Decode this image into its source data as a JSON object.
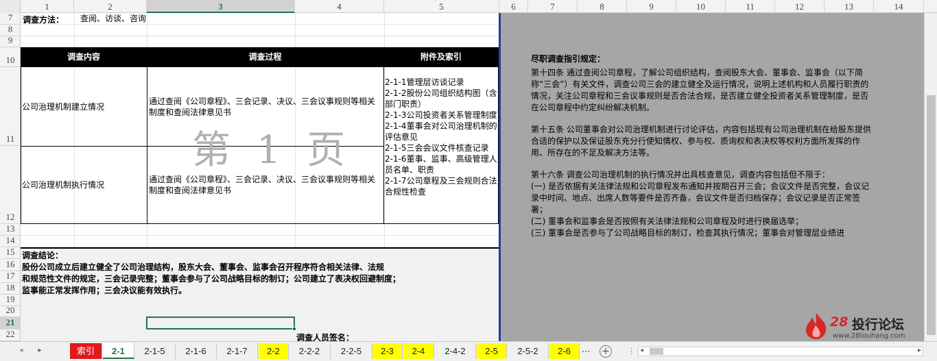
{
  "columns": [
    "1",
    "2",
    "3",
    "4",
    "5",
    "6",
    "7",
    "8",
    "9",
    "10",
    "11",
    "12",
    "13",
    "14"
  ],
  "rows": [
    "7",
    "8",
    "9",
    "10",
    "11",
    "12",
    "13",
    "14",
    "15",
    "16",
    "17",
    "18",
    "19",
    "20",
    "21",
    "22"
  ],
  "sheet": {
    "method_label": "调查方法：",
    "method_value": "查阅、访谈、咨询",
    "table_headers": [
      "调查内容",
      "调查过程",
      "附件及索引"
    ],
    "table_rows": [
      {
        "content": "公司治理机制建立情况",
        "process": "通过查阅《公司章程》、三会记录、决议、三会议事规则等相关制度和查阅法律意见书"
      },
      {
        "content": "公司治理机制执行情况",
        "process": "通过查阅《公司章程》、三会记录、决议、三会议事规则等相关制度和查阅法律意见书"
      }
    ],
    "attachments": "2-1-1管理层访谈记录\n2-1-2股份公司组织结构图（含部门职责）\n2-1-3公司投资者关系管理制度\n2-1-4董事会对公司治理机制的评估意见\n2-1-5三会会议文件核查记录\n2-1-6董事、监事、高级管理人员名单、职责\n2-1-7公司章程及三会规则合法合规性检查",
    "watermark": "第 1 页",
    "conclusion_label": "调查结论：",
    "conclusion_lines": [
      "股份公司成立后建立健全了公司治理结构，股东大会、董事会、监事会召开程序符合相关法律、法规",
      "和规范性文件的规定，三会记录完整；董事会参与了公司战略目标的制订；公司建立了表决权回避制度；",
      "监事能正常发挥作用；三会决议能有效执行。"
    ],
    "signature_label": "调查人员签名："
  },
  "guide": {
    "title": "尽职调查指引规定：",
    "p1": "第十四条 通过查阅公司章程，了解公司组织结构，查阅股东大会、董事会、监事会（以下简称“三会”）有关文件，调查公司三会的建立健全及运行情况，说明上述机构和人员履行职责的情况，关注公司章程和三会议事规则是否合法合规，是否建立健全投资者关系管理制度，是否在公司章程中约定纠纷解决机制。",
    "p2": "第十五条 公司董事会对公司治理机制进行讨论评估，内容包括现有公司治理机制在给股东提供合适的保护以及保证股东充分行使知情权、参与权、质询权和表决权等权利方面所发挥的作用、所存在的不足及解决方法等。",
    "p3": "第十六条 调查公司治理机制的执行情况并出具核查意见，调查内容包括但不限于：\n(一) 是否依据有关法律法规和公司章程发布通知并按期召开三会；会议文件是否完整，会议记录中时间、地点、出席人数等要件是否齐备，会议文件是否归档保存；会议记录是否正常签署；\n(二) 董事会和监事会是否按照有关法律法规和公司章程及时进行换届选举；\n(三) 董事会是否参与了公司战略目标的制订，检查其执行情况；董事会对管理层业绩进"
  },
  "logo": {
    "num": "28",
    "name": "投行论坛",
    "url": "www.28touhang.com"
  },
  "tabs": [
    {
      "label": "索引",
      "style": "red"
    },
    {
      "label": "2-1",
      "style": "active"
    },
    {
      "label": "2-1-5",
      "style": ""
    },
    {
      "label": "2-1-6",
      "style": ""
    },
    {
      "label": "2-1-7",
      "style": ""
    },
    {
      "label": "2-2",
      "style": "yellow"
    },
    {
      "label": "2-2-2",
      "style": ""
    },
    {
      "label": "2-2-5",
      "style": ""
    },
    {
      "label": "2-3",
      "style": "yellow"
    },
    {
      "label": "2-4",
      "style": "yellow"
    },
    {
      "label": "2-4-2",
      "style": ""
    },
    {
      "label": "2-5",
      "style": "yellow"
    },
    {
      "label": "2-5-2",
      "style": ""
    },
    {
      "label": "2-6",
      "style": "yellow"
    }
  ],
  "tab_more": "...",
  "add_sheet": "+",
  "colors": {
    "accent": "#217346",
    "tab_red": "#e01a1a",
    "tab_yellow": "#ffff00",
    "panel_grey": "#a6a6a6",
    "divider": "#1f3e99"
  }
}
